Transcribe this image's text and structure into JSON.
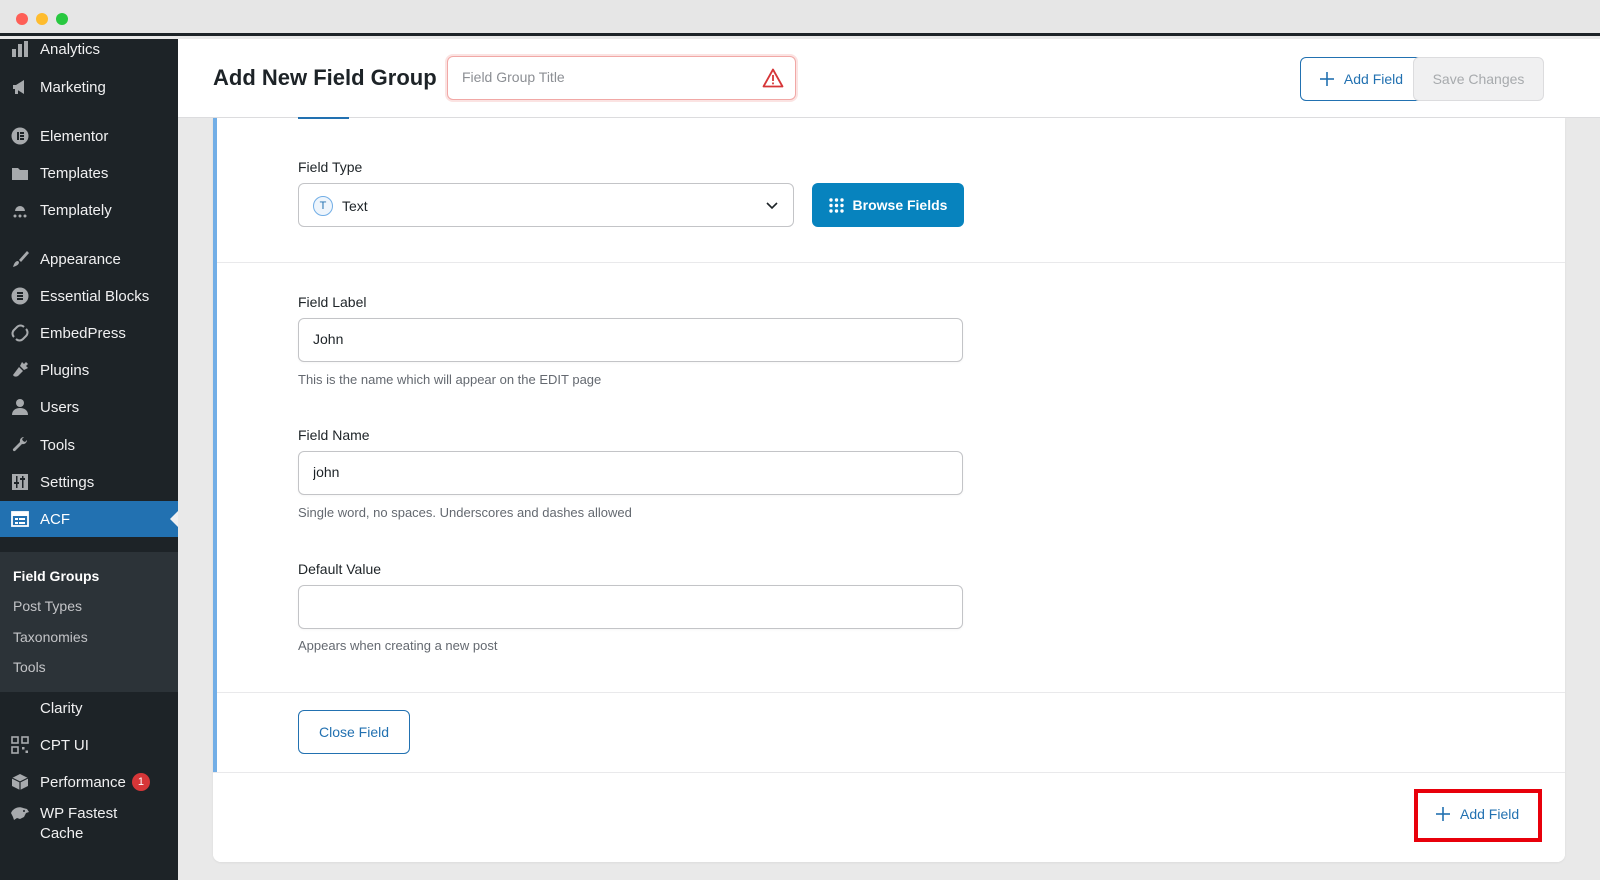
{
  "window": {
    "controls": [
      "close",
      "minimize",
      "maximize"
    ]
  },
  "sidebar": {
    "items": [
      {
        "label": "Analytics",
        "icon": "bar-chart-icon"
      },
      {
        "label": "Marketing",
        "icon": "megaphone-icon"
      },
      {
        "label": "Elementor",
        "icon": "elementor-icon"
      },
      {
        "label": "Templates",
        "icon": "folder-icon"
      },
      {
        "label": "Templately",
        "icon": "templately-icon"
      },
      {
        "label": "Appearance",
        "icon": "paintbrush-icon"
      },
      {
        "label": "Essential Blocks",
        "icon": "essential-blocks-icon"
      },
      {
        "label": "EmbedPress",
        "icon": "embedpress-icon"
      },
      {
        "label": "Plugins",
        "icon": "plug-icon"
      },
      {
        "label": "Users",
        "icon": "user-icon"
      },
      {
        "label": "Tools",
        "icon": "wrench-icon"
      },
      {
        "label": "Settings",
        "icon": "sliders-icon"
      },
      {
        "label": "ACF",
        "icon": "acf-icon"
      },
      {
        "label": "Clarity",
        "icon": ""
      },
      {
        "label": "CPT UI",
        "icon": "qr-grid-icon"
      },
      {
        "label": "Performance",
        "icon": "performance-icon",
        "badge": "1"
      },
      {
        "label": "WP Fastest",
        "label2": "Cache",
        "icon": "cheetah-icon"
      }
    ],
    "submenu": [
      "Field Groups",
      "Post Types",
      "Taxonomies",
      "Tools"
    ]
  },
  "header": {
    "title": "Add New Field Group",
    "title_placeholder": "Field Group Title",
    "add_field_label": "Add Field",
    "save_label": "Save Changes"
  },
  "field": {
    "type_label": "Field Type",
    "type_value": "Text",
    "browse_label": "Browse Fields",
    "label_label": "Field Label",
    "label_value": "John",
    "label_help": "This is the name which will appear on the EDIT page",
    "name_label": "Field Name",
    "name_value": "john",
    "name_help": "Single word, no spaces. Underscores and dashes allowed",
    "default_label": "Default Value",
    "default_value": "",
    "default_help": "Appears when creating a new post",
    "close_label": "Close Field"
  },
  "footer": {
    "add_field_label": "Add Field"
  },
  "colors": {
    "accent": "#2271b1",
    "primary_button": "#0783be",
    "sidebar": "#1d2327",
    "highlight": "#e8000b",
    "warning": "#d63638"
  }
}
